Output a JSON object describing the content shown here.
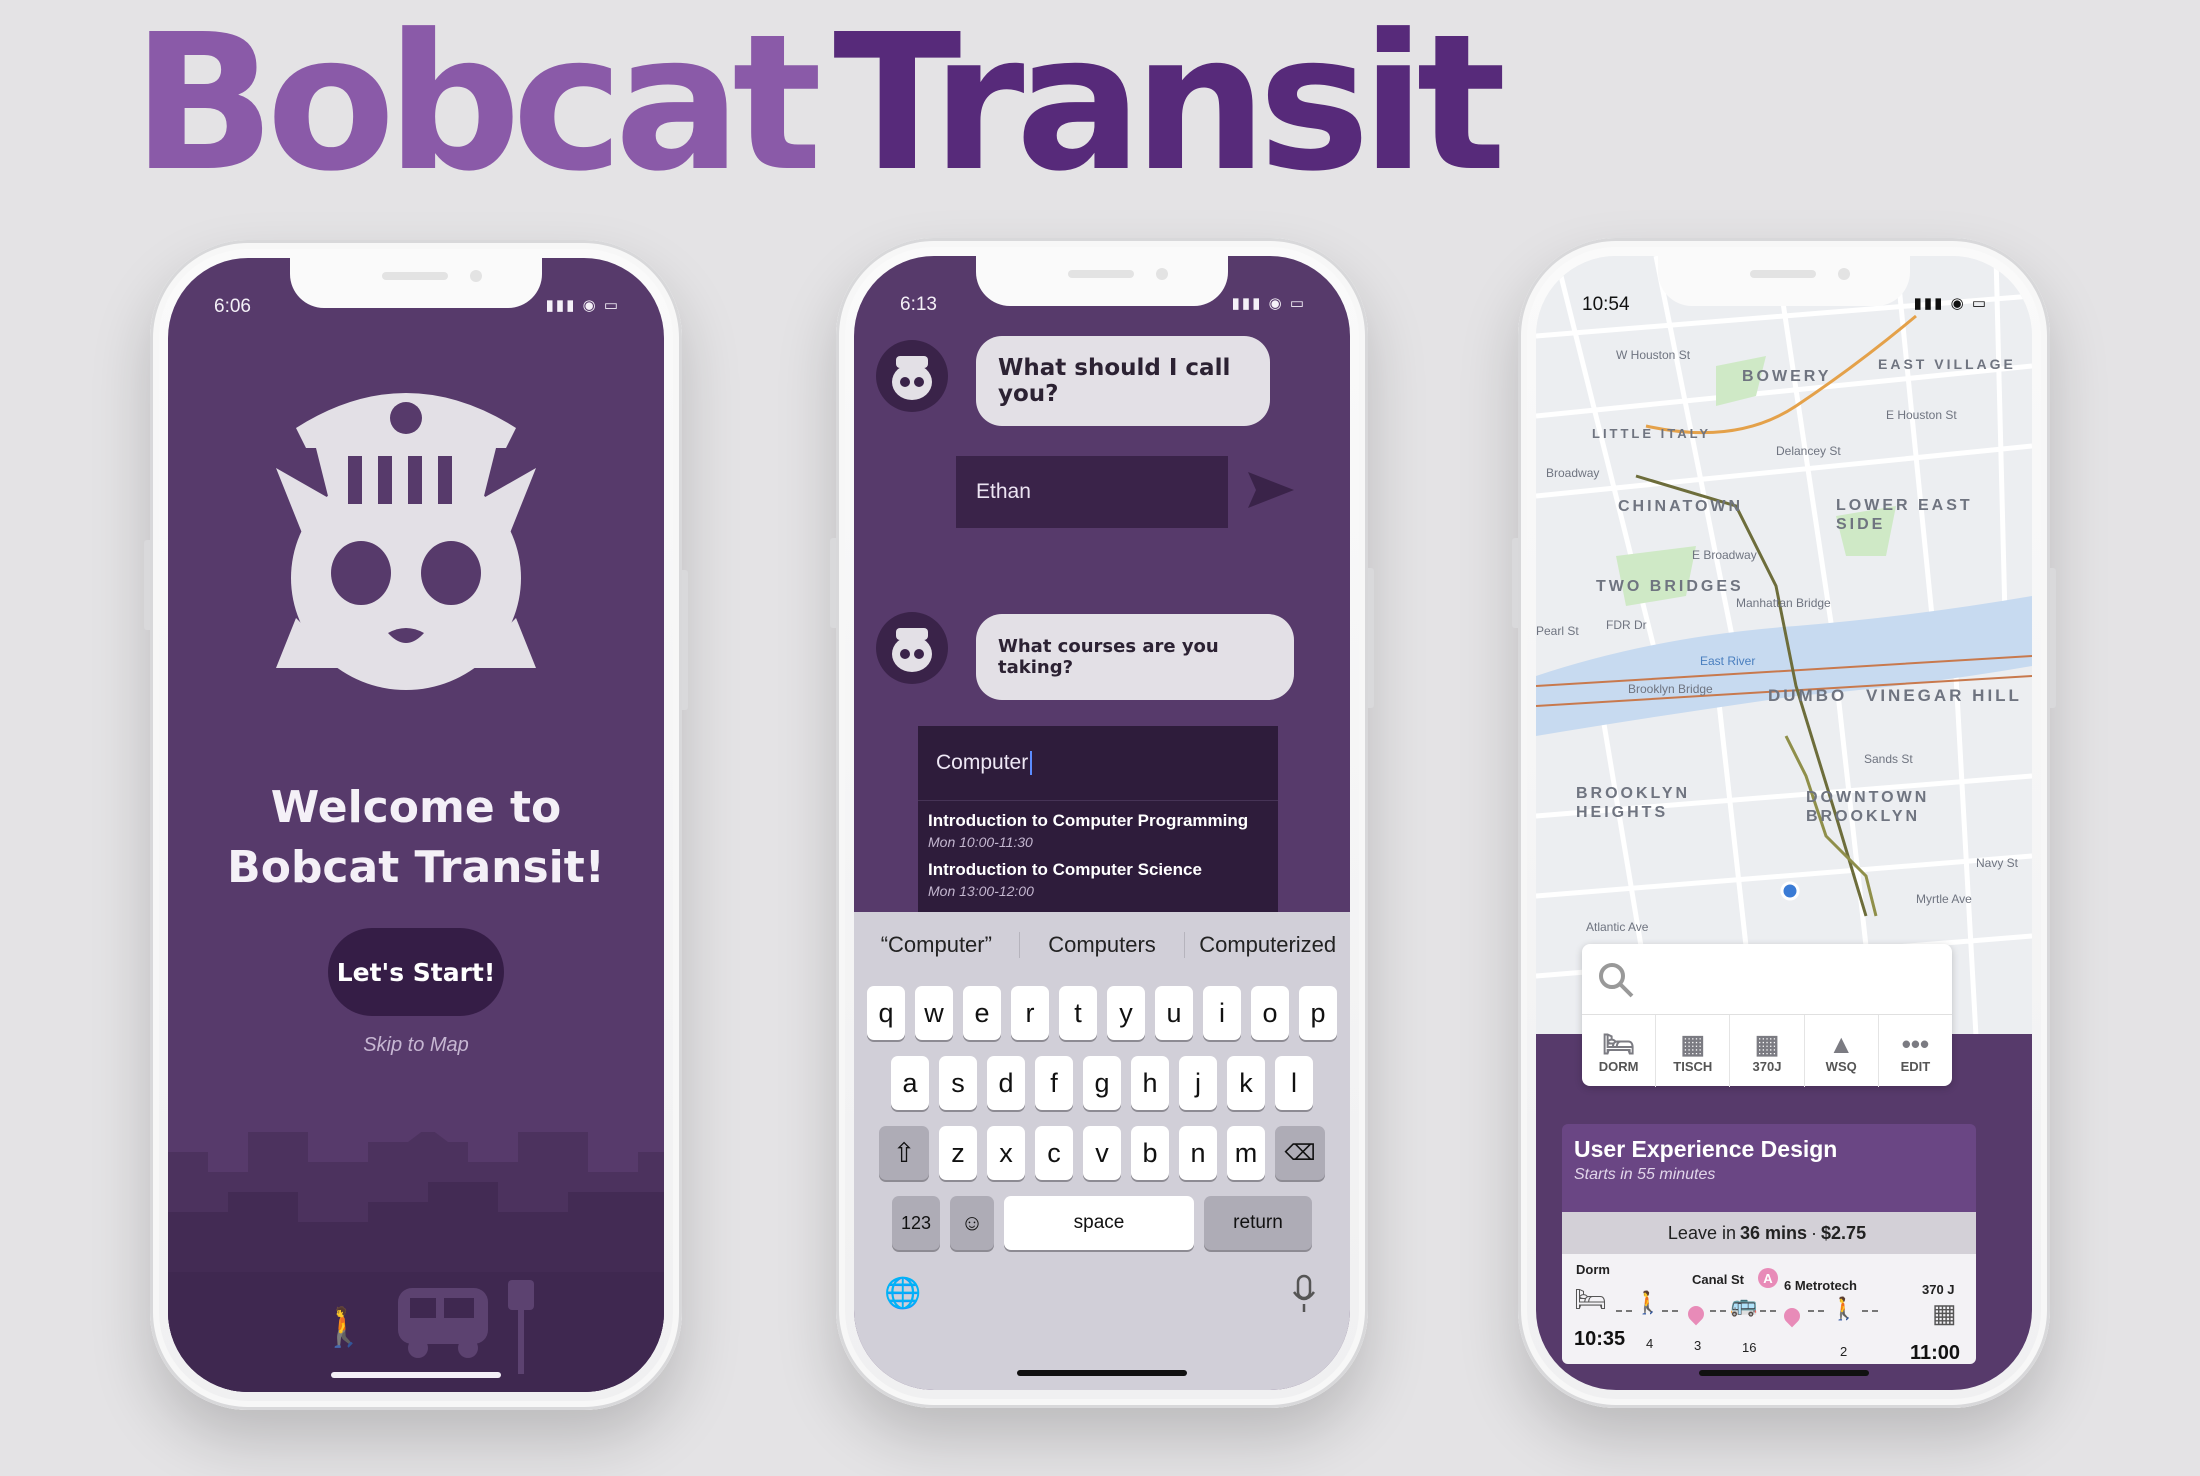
{
  "hero": {
    "word1": "Bobcat",
    "word2": "Transit"
  },
  "colors": {
    "primary": "#573a6b",
    "light_purple": "#8a5aa8",
    "dark_purple": "#351d46",
    "accent_pink": "#e88bb8"
  },
  "welcome_screen": {
    "time": "6:06",
    "title_line1": "Welcome to",
    "title_line2": "Bobcat Transit!",
    "start_button": "Let's Start!",
    "skip_link": "Skip to Map"
  },
  "chat_screen": {
    "time": "6:13",
    "question1": "What should I call you?",
    "name_value": "Ethan",
    "question2": "What courses are you taking?",
    "course_query": "Computer",
    "results": [
      {
        "title": "Introduction to Computer Programming",
        "time": "Mon 10:00-11:30"
      },
      {
        "title": "Introduction to Computer Science",
        "time": "Mon 13:00-12:00"
      }
    ],
    "suggestions": [
      "“Computer”",
      "Computers",
      "Computerized"
    ],
    "keyboard": {
      "row1": [
        "q",
        "w",
        "e",
        "r",
        "t",
        "y",
        "u",
        "i",
        "o",
        "p"
      ],
      "row2": [
        "a",
        "s",
        "d",
        "f",
        "g",
        "h",
        "j",
        "k",
        "l"
      ],
      "row3": [
        "z",
        "x",
        "c",
        "v",
        "b",
        "n",
        "m"
      ],
      "numbers_key": "123",
      "space_key": "space",
      "return_key": "return"
    }
  },
  "map_screen": {
    "time": "10:54",
    "neighborhoods": [
      "BOWERY",
      "EAST VILLAGE",
      "LITTLE ITALY",
      "CHINATOWN",
      "LOWER EAST SIDE",
      "TWO BRIDGES",
      "DUMBO",
      "VINEGAR HILL",
      "BROOKLYN HEIGHTS",
      "DOWNTOWN BROOKLYN"
    ],
    "streets": [
      "W Houston St",
      "E Houston St",
      "Delancey St",
      "E Broadway",
      "Broadway",
      "Pearl St",
      "FDR Dr",
      "East River",
      "Brooklyn Bridge",
      "Manhattan Bridge",
      "Sands St",
      "Navy St",
      "Myrtle Ave",
      "Atlantic Ave"
    ],
    "quick_destinations": [
      {
        "label": "DORM",
        "icon": "bed-icon"
      },
      {
        "label": "TISCH",
        "icon": "building-icon"
      },
      {
        "label": "370J",
        "icon": "building-icon"
      },
      {
        "label": "WSQ",
        "icon": "tree-icon"
      },
      {
        "label": "EDIT",
        "icon": "more-icon"
      }
    ],
    "trip": {
      "course": "User Experience Design",
      "starts_in": "Starts in 55 minutes",
      "leave_prefix": "Leave in",
      "leave_time": "36 mins",
      "price": "$2.75",
      "origin": "Dorm",
      "stop1": "Canal St",
      "train_line": "A",
      "stop2": "6 Metrotech",
      "destination": "370 J",
      "depart_time": "10:35",
      "arrive_time": "11:00",
      "walk1_min": "4",
      "segment2_min": "3",
      "segment3_min": "16",
      "walk2_min": "2"
    }
  }
}
